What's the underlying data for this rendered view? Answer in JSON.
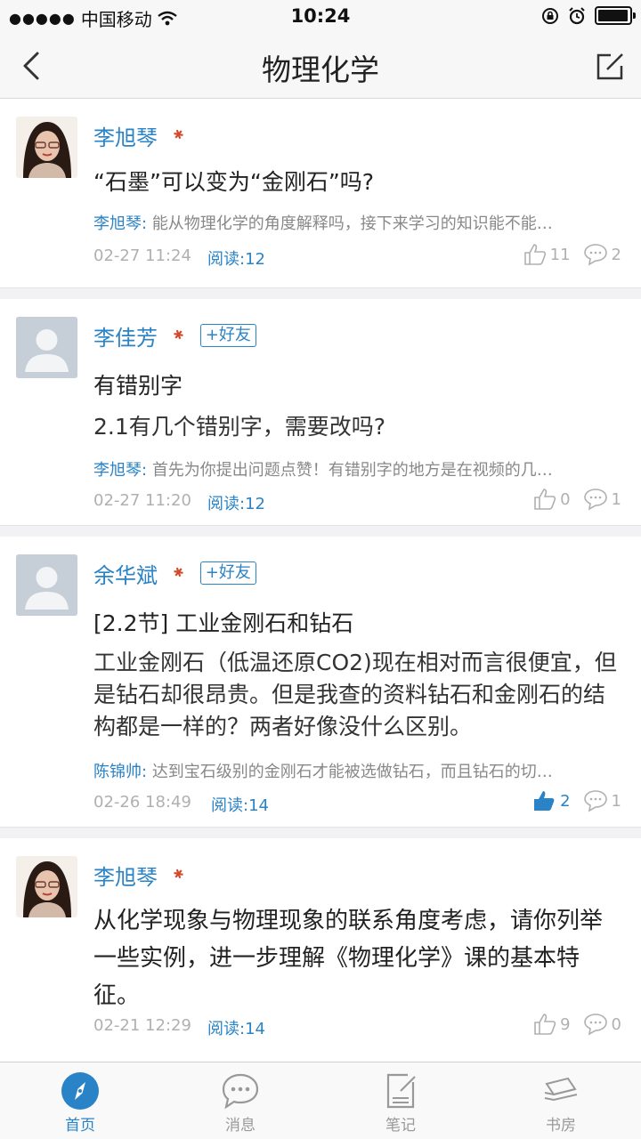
{
  "status_bar": {
    "carrier": "中国移动",
    "time": "10:24"
  },
  "nav": {
    "title": "物理化学"
  },
  "posts": [
    {
      "author": "李旭琴",
      "avatar": "photo",
      "show_friend": false,
      "title": "“石墨”可以变为“金刚石”吗?",
      "body": "",
      "reply_author": "李旭琴:",
      "reply_text": "能从物理化学的角度解释吗，接下来学习的知识能不能…",
      "time": "02-27 11:24",
      "read": "阅读:12",
      "likes": "11",
      "comments": "2",
      "liked": false
    },
    {
      "author": "李佳芳",
      "avatar": "default",
      "show_friend": true,
      "friend_label": "+好友",
      "title": "有错别字",
      "body": "2.1有几个错别字，需要改吗?",
      "reply_author": "李旭琴:",
      "reply_text": "首先为你提出问题点赞！有错别字的地方是在视频的几…",
      "time": "02-27 11:20",
      "read": "阅读:12",
      "likes": "0",
      "comments": "1",
      "liked": false
    },
    {
      "author": "余华斌",
      "avatar": "default",
      "show_friend": true,
      "friend_label": "+好友",
      "title": "[2.2节] 工业金刚石和钻石",
      "body": "工业金刚石（低温还原CO2)现在相对而言很便宜，但是钻石却很昂贵。但是我查的资料钻石和金刚石的结构都是一样的？两者好像没什么区别。",
      "reply_author": "陈锦帅:",
      "reply_text": "达到宝石级别的金刚石才能被选做钻石，而且钻石的切…",
      "time": "02-26 18:49",
      "read": "阅读:14",
      "likes": "2",
      "comments": "1",
      "liked": true
    },
    {
      "author": "李旭琴",
      "avatar": "photo",
      "show_friend": false,
      "title": "",
      "body": "从化学现象与物理现象的联系角度考虑，请你列举一些实例，进一步理解《物理化学》课的基本特征。",
      "reply_author": "",
      "reply_text": "",
      "time": "02-21 12:29",
      "read": "阅读:14",
      "likes": "9",
      "comments": "0",
      "liked": false
    }
  ],
  "tabs": [
    {
      "label": "首页",
      "icon": "compass-icon",
      "active": true
    },
    {
      "label": "消息",
      "icon": "chat-bubble-icon",
      "active": false
    },
    {
      "label": "笔记",
      "icon": "note-icon",
      "active": false
    },
    {
      "label": "书房",
      "icon": "books-icon",
      "active": false
    }
  ],
  "colors": {
    "accent": "#2a83c6",
    "muted": "#b0b0b0"
  }
}
